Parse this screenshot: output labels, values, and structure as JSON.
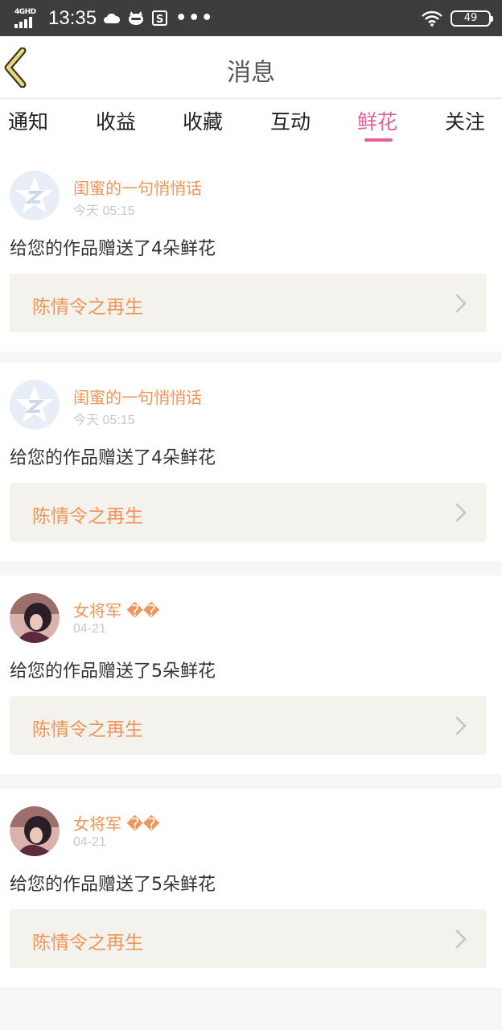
{
  "status_bar": {
    "network": "4GHD",
    "time": "13:35",
    "icons": [
      "weather-icon",
      "cat-icon",
      "s-icon"
    ],
    "more": "•••",
    "battery": "49"
  },
  "header": {
    "title": "消息"
  },
  "tabs": [
    {
      "label": "通知"
    },
    {
      "label": "收益"
    },
    {
      "label": "收藏"
    },
    {
      "label": "互动"
    },
    {
      "label": "鲜花",
      "active": true
    },
    {
      "label": "关注"
    }
  ],
  "messages": [
    {
      "user": "闺蜜的一句悄悄话",
      "time": "今天 05:15",
      "text": "给您的作品赠送了4朵鲜花",
      "work": "陈情令之再生",
      "avatar": "default-avatar"
    },
    {
      "user": "闺蜜的一句悄悄话",
      "time": "今天 05:15",
      "text": "给您的作品赠送了4朵鲜花",
      "work": "陈情令之再生",
      "avatar": "default-avatar"
    },
    {
      "user": "女将军 ��",
      "time": "04-21",
      "text": "给您的作品赠送了5朵鲜花",
      "work": "陈情令之再生",
      "avatar": "photo-avatar"
    },
    {
      "user": "女将军 ��",
      "time": "04-21",
      "text": "给您的作品赠送了5朵鲜花",
      "work": "陈情令之再生",
      "avatar": "photo-avatar"
    }
  ],
  "colors": {
    "accent": "#e0609c",
    "username": "#f0955a",
    "work_box": "#f3f2ec",
    "status_bar": "#3d3d3d"
  }
}
